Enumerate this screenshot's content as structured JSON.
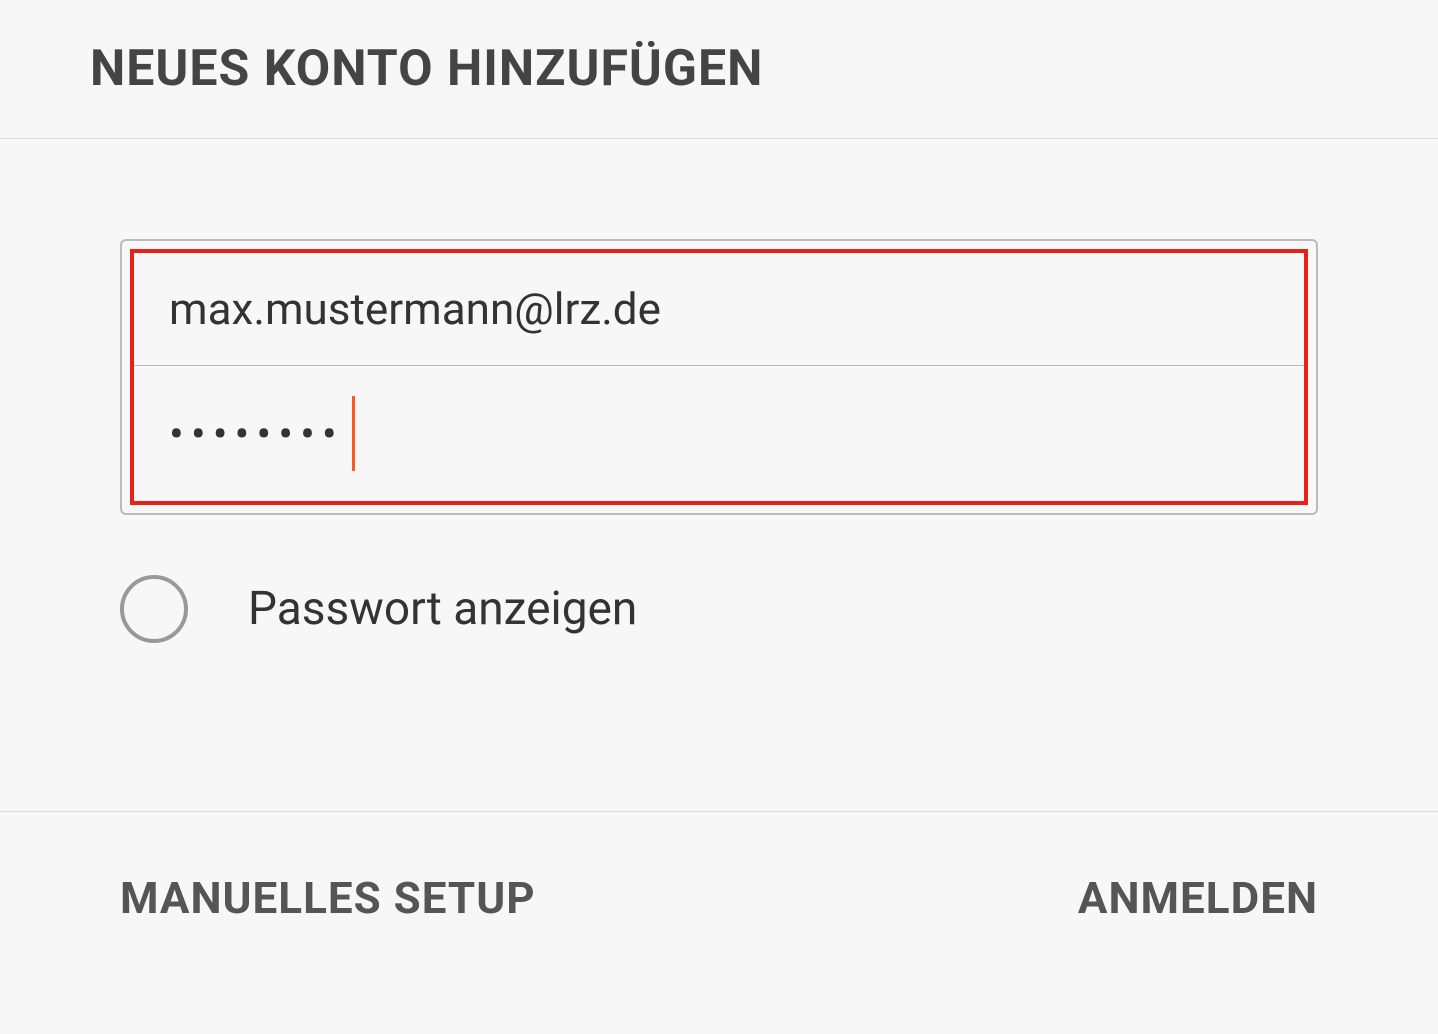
{
  "header": {
    "title": "NEUES KONTO HINZUFÜGEN"
  },
  "form": {
    "email_value": "max.mustermann@lrz.de",
    "password_display": "••••••••",
    "show_password_label": "Passwort anzeigen"
  },
  "footer": {
    "manual_setup_label": "MANUELLES SETUP",
    "signin_label": "ANMELDEN"
  },
  "colors": {
    "highlight": "#e62117",
    "caret": "#ff5722"
  }
}
